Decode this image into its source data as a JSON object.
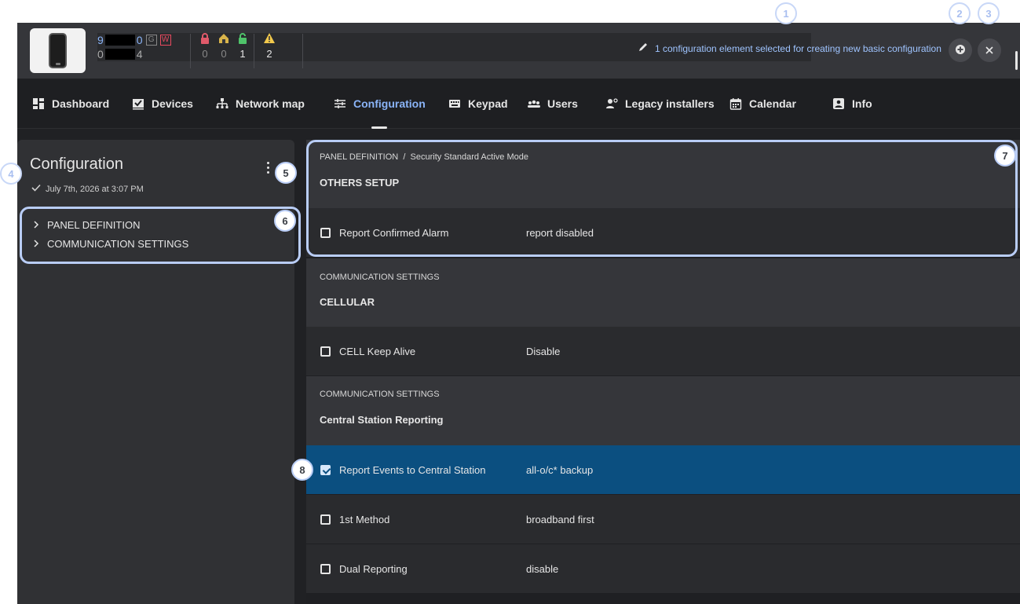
{
  "header": {
    "device_id_line1_prefix": "9",
    "device_id_line1_suffix": "0",
    "badge_g": "G",
    "badge_w": "W",
    "device_id_line2_prefix": "0",
    "device_id_line2_suffix": "4",
    "status_icons": [
      "lock-red-icon",
      "home-yellow-icon",
      "unlock-green-icon",
      "warning-icon"
    ],
    "status_values": [
      "0",
      "0",
      "1",
      "2"
    ],
    "selection_info": "1 configuration element selected for creating new basic configuration"
  },
  "tabs": [
    {
      "label": "Dashboard",
      "icon": "dashboard-icon"
    },
    {
      "label": "Devices",
      "icon": "devices-icon"
    },
    {
      "label": "Network map",
      "icon": "network-map-icon"
    },
    {
      "label": "Configuration",
      "icon": "configuration-icon",
      "active": true
    },
    {
      "label": "Keypad",
      "icon": "keypad-icon"
    },
    {
      "label": "Users",
      "icon": "users-icon"
    },
    {
      "label": "Legacy installers",
      "icon": "legacy-installers-icon"
    },
    {
      "label": "Calendar",
      "icon": "calendar-icon"
    },
    {
      "label": "Info",
      "icon": "info-icon"
    }
  ],
  "left": {
    "title": "Configuration",
    "saved_at": "July 7th, 2026 at 3:07 PM",
    "tree": [
      "PANEL DEFINITION",
      "COMMUNICATION SETTINGS"
    ]
  },
  "sections": [
    {
      "crumb_main": "PANEL DEFINITION",
      "crumb_sub": "Security Standard Active Mode",
      "title": "OTHERS SETUP",
      "rows": [
        {
          "label": "Report Confirmed Alarm",
          "value": "report disabled",
          "checked": false
        }
      ]
    },
    {
      "crumb_main": "COMMUNICATION SETTINGS",
      "title": "CELLULAR",
      "rows": [
        {
          "label": "CELL Keep Alive",
          "value": "Disable",
          "checked": false
        }
      ]
    },
    {
      "crumb_main": "COMMUNICATION SETTINGS",
      "title": "Central Station Reporting",
      "rows": [
        {
          "label": "Report Events to Central Station",
          "value": "all-o/c* backup",
          "checked": true
        },
        {
          "label": "1st Method",
          "value": "broadband first",
          "checked": false
        },
        {
          "label": "Dual Reporting",
          "value": "disable",
          "checked": false
        }
      ]
    }
  ],
  "markers": [
    "1",
    "2",
    "3",
    "4",
    "5",
    "6",
    "7",
    "8"
  ],
  "colors": {
    "accent": "#8ab4f8",
    "selected_row": "#0b4f80",
    "marker_border": "#b9cdf6"
  }
}
